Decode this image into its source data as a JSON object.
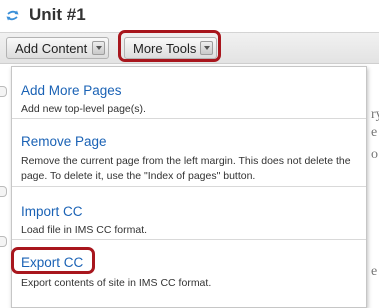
{
  "header": {
    "title": "Unit #1",
    "icon": "sync-arrows-icon"
  },
  "toolbar": {
    "add_content_label": "Add Content",
    "more_tools_label": "More Tools"
  },
  "menu": {
    "items": [
      {
        "title": "Add More Pages",
        "description": "Add new top-level page(s)."
      },
      {
        "title": "Remove Page",
        "description": "Remove the current page from the left margin. This does not delete the page. To delete it, use the \"Index of pages\" button."
      },
      {
        "title": "Import CC",
        "description": "Load file in IMS CC format."
      },
      {
        "title": "Export CC",
        "description": "Export contents of site in IMS CC format."
      }
    ]
  },
  "colors": {
    "highlight": "#a8161d",
    "link": "#1a62b5"
  }
}
